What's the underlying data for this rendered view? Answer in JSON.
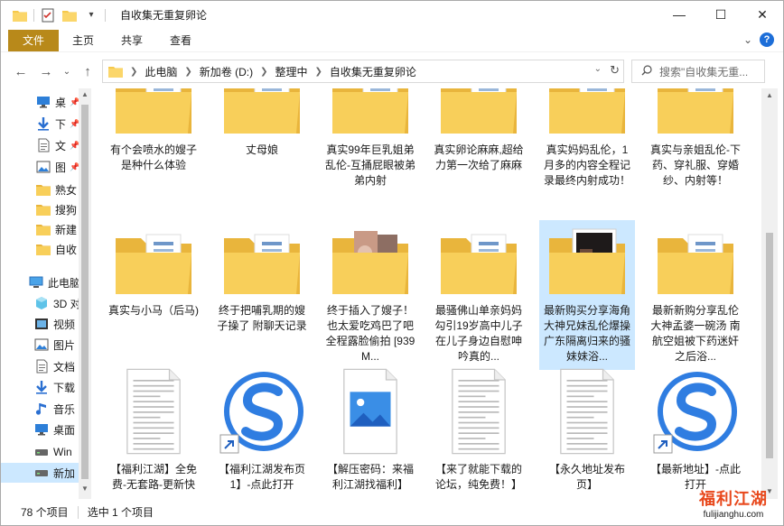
{
  "window": {
    "title": "自收集无重复卵论",
    "controls": {
      "minimize": "—",
      "maximize": "☐",
      "close": "✕"
    }
  },
  "ribbon": {
    "tabs": [
      {
        "label": "文件"
      },
      {
        "label": "主页"
      },
      {
        "label": "共享"
      },
      {
        "label": "查看"
      }
    ],
    "expand": "⌄",
    "help": "?"
  },
  "nav": {
    "back": "←",
    "forward": "→",
    "recent": "⌄",
    "up": "↑"
  },
  "address": {
    "crumbs": [
      "此电脑",
      "新加卷 (D:)",
      "整理中",
      "自收集无重复卵论"
    ],
    "dropdown": "⌄",
    "refresh": "↻"
  },
  "search": {
    "placeholder": "搜索\"自收集无重..."
  },
  "sidebar": {
    "items": [
      {
        "label": "桌",
        "icon": "desktop-icon",
        "pinned": true
      },
      {
        "label": "下",
        "icon": "download-icon",
        "pinned": true
      },
      {
        "label": "文",
        "icon": "document-icon",
        "pinned": true
      },
      {
        "label": "图",
        "icon": "picture-icon",
        "pinned": true
      },
      {
        "label": "熟女",
        "icon": "folder-icon",
        "pinned": false
      },
      {
        "label": "搜狗",
        "icon": "folder-icon",
        "pinned": false
      },
      {
        "label": "新建",
        "icon": "folder-icon",
        "pinned": false
      },
      {
        "label": "自收",
        "icon": "folder-icon",
        "pinned": false
      },
      {
        "label": "此电脑",
        "icon": "computer-icon",
        "pinned": false
      },
      {
        "label": "3D 对",
        "icon": "cube-icon",
        "pinned": false
      },
      {
        "label": "视频",
        "icon": "video-icon",
        "pinned": false
      },
      {
        "label": "图片",
        "icon": "picture-icon",
        "pinned": false
      },
      {
        "label": "文档",
        "icon": "document-icon",
        "pinned": false
      },
      {
        "label": "下载",
        "icon": "download-icon",
        "pinned": false
      },
      {
        "label": "音乐",
        "icon": "music-icon",
        "pinned": false
      },
      {
        "label": "桌面",
        "icon": "desktop-icon",
        "pinned": false
      },
      {
        "label": "Win",
        "icon": "drive-icon",
        "pinned": false
      },
      {
        "label": "新加",
        "icon": "drive-icon",
        "pinned": false,
        "selected": true
      }
    ]
  },
  "files": [
    {
      "label": "有个会喷水的嫂子是种什么体验",
      "kind": "folder"
    },
    {
      "label": "丈母娘",
      "kind": "folder"
    },
    {
      "label": "真实99年巨乳姐弟乱伦-互捅屁眼被弟弟内射",
      "kind": "folder"
    },
    {
      "label": "真实卵论麻麻,超给力第一次给了麻麻",
      "kind": "folder"
    },
    {
      "label": "真实妈妈乱伦，1月多的内容全程记录最终内射成功！",
      "kind": "folder"
    },
    {
      "label": "真实与亲姐乱伦-下药、穿礼服、穿婚纱、内射等！",
      "kind": "folder"
    },
    {
      "label": "真实与小马（后马)",
      "kind": "folder"
    },
    {
      "label": "终于把哺乳期的嫂子操了 附聊天记录",
      "kind": "folder"
    },
    {
      "label": "终于插入了嫂子！也太爱吃鸡巴了吧全程露脸偷拍 [939M...",
      "kind": "folder-photo"
    },
    {
      "label": "最骚佛山单亲妈妈勾引19岁高中儿子在儿子身边自慰呻吟真的...",
      "kind": "folder"
    },
    {
      "label": "最新购买分享海角大神兄妹乱伦爆操广东隔离归来的骚妹妹浴...",
      "kind": "folder-dark",
      "selected": true
    },
    {
      "label": "最新新购分享乱伦大神孟婆一碗汤 南航空姐被下药迷奸之后浴...",
      "kind": "folder"
    },
    {
      "label": "【福利江湖】全免费-无套路-更新快",
      "kind": "text"
    },
    {
      "label": "【福利江湖发布页1】-点此打开",
      "kind": "shortcut"
    },
    {
      "label": "【解压密码：来福利江湖找福利】",
      "kind": "image"
    },
    {
      "label": "【来了就能下载的论坛，纯免费！】",
      "kind": "text"
    },
    {
      "label": "【永久地址发布页】",
      "kind": "text"
    },
    {
      "label": "【最新地址】-点此打开",
      "kind": "shortcut"
    }
  ],
  "status": {
    "count": "78 个项目",
    "selected": "选中 1 个项目"
  },
  "watermark": {
    "line1": "福利江湖",
    "line2": "fulijianghu.com"
  },
  "colors": {
    "file_tab": "#b8891a",
    "selection": "#cce8ff",
    "folder": "#f6c94c",
    "logo_blue": "#2f7de1"
  }
}
